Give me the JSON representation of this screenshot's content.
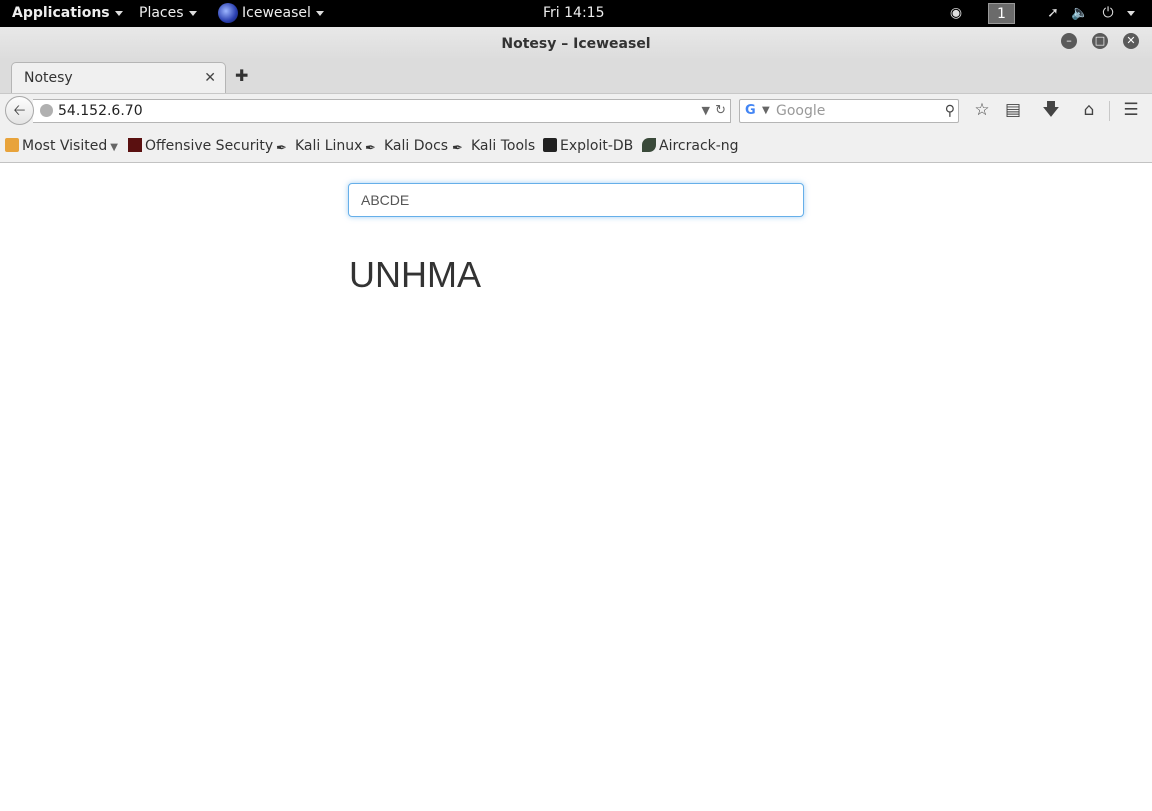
{
  "topbar": {
    "applications": "Applications",
    "places": "Places",
    "app_name": "Iceweasel",
    "clock": "Fri 14:15",
    "workspace": "1"
  },
  "window": {
    "title": "Notesy – Iceweasel"
  },
  "tabs": [
    {
      "label": "Notesy"
    }
  ],
  "navbar": {
    "url": "54.152.6.70",
    "search_placeholder": "Google"
  },
  "bookmarks": [
    {
      "label": "Most Visited",
      "icon": "folder-icon"
    },
    {
      "label": "Offensive Security",
      "icon": "offsec-icon"
    },
    {
      "label": "Kali Linux",
      "icon": "kali-dragon-icon"
    },
    {
      "label": "Kali Docs",
      "icon": "kali-dragon-icon"
    },
    {
      "label": "Kali Tools",
      "icon": "kali-dragon-icon"
    },
    {
      "label": "Exploit-DB",
      "icon": "exploitdb-icon"
    },
    {
      "label": "Aircrack-ng",
      "icon": "aircrack-icon"
    }
  ],
  "page": {
    "note_input_value": "ABCDE",
    "result_text": "UNHMA"
  }
}
